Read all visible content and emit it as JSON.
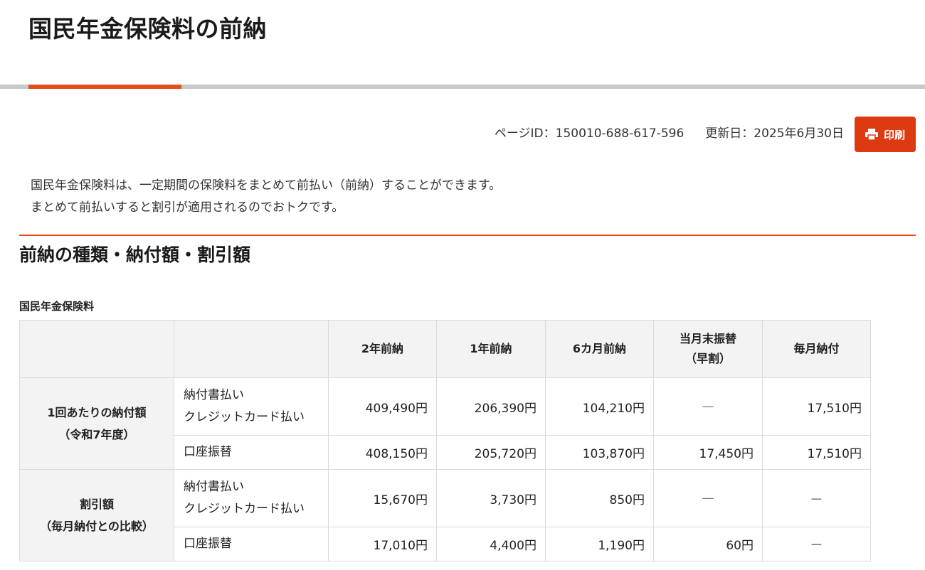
{
  "page": {
    "title": "国民年金保険料の前納",
    "page_id": "ページID：150010-688-617-596",
    "updated": "更新日：2025年6月30日",
    "print_label": "印刷",
    "print_icon": "printer-icon",
    "accent_color": "#e2511b",
    "button_color": "#dd3a12"
  },
  "intro": {
    "line1": "国民年金保険料は、一定期間の保険料をまとめて前払い（前納）することができます。",
    "line2": "まとめて前払いすると割引が適用されるのでおトクです。"
  },
  "section": {
    "heading": "前納の種類・納付額・割引額",
    "table_caption": "国民年金保険料"
  },
  "table": {
    "headers": {
      "h1": "2年前納",
      "h2": "1年前納",
      "h3": "6カ月前納",
      "h4_line1": "当月末振替",
      "h4_line2": "（早割）",
      "h5": "毎月納付"
    },
    "group1": {
      "label_line1": "1回あたりの納付額",
      "label_line2": "（令和7年度）",
      "row1": {
        "method_line1": "納付書払い",
        "method_line2": "クレジットカード払い",
        "values": [
          "409,490円",
          "206,390円",
          "104,210円",
          "—",
          "17,510円"
        ]
      },
      "row2": {
        "method": "口座振替",
        "values": [
          "408,150円",
          "205,720円",
          "103,870円",
          "17,450円",
          "17,510円"
        ]
      }
    },
    "group2": {
      "label_line1": "割引額",
      "label_line2": "（毎月納付との比較）",
      "row1": {
        "method_line1": "納付書払い",
        "method_line2": "クレジットカード払い",
        "values": [
          "15,670円",
          "3,730円",
          "850円",
          "—",
          "ー"
        ]
      },
      "row2": {
        "method": "口座振替",
        "values": [
          "17,010円",
          "4,400円",
          "1,190円",
          "60円",
          "ー"
        ]
      }
    }
  }
}
